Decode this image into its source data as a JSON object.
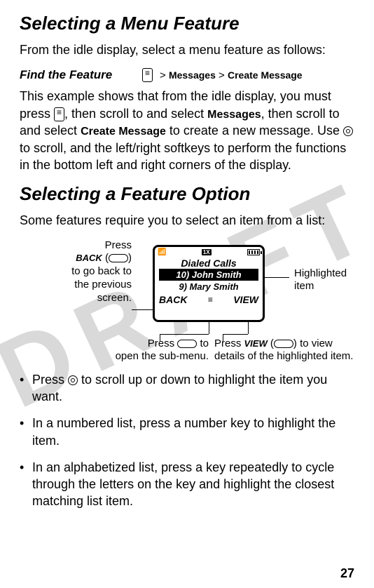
{
  "page_number": "27",
  "watermark": "DRAFT",
  "section1": {
    "heading": "Selecting a Menu Feature",
    "intro": "From the idle display, select a menu feature as follows:",
    "find_label": "Find the Feature",
    "path_sep": ">",
    "path_item1": "Messages",
    "path_item2": "Create Message",
    "example_p1": "This example shows that from the idle display, you must press ",
    "example_p2": ", then scroll to and select ",
    "example_bold1": "Messages",
    "example_p3": ", then scroll to and select ",
    "example_bold2": "Create Message",
    "example_p4": " to create a new message. Use ",
    "example_p5": " to scroll, and the left/right softkeys to perform the functions in the bottom left and right corners of the display."
  },
  "section2": {
    "heading": "Selecting a Feature Option",
    "intro": "Some features require you to select an item from a list:"
  },
  "diagram": {
    "screen_title": "Dialed Calls",
    "list_item1": "10) John Smith",
    "list_item2": "9) Mary Smith",
    "softkey_left": "BACK",
    "softkey_right": "VIEW",
    "status_ix": "1X",
    "callout_left_p1": "Press",
    "callout_left_back": "BACK",
    "callout_left_p2": "to go back to",
    "callout_left_p3": "the previous",
    "callout_left_p4": "screen.",
    "callout_right_p1": "Highlighted",
    "callout_right_p2": "item",
    "callout_bl_p1": "Press ",
    "callout_bl_p2": " to",
    "callout_bl_p3": "open the sub-menu.",
    "callout_br_p1": "Press ",
    "callout_br_view": "VIEW",
    "callout_br_p2": " (",
    "callout_br_p3": ") to view",
    "callout_br_p4": "details of the highlighted item."
  },
  "bullets": {
    "b1_p1": "Press ",
    "b1_p2": " to scroll up or down to highlight the item you want.",
    "b2": "In a numbered list, press a number key to highlight the item.",
    "b3": "In an alphabetized list, press a key repeatedly to cycle through the letters on the key and highlight the closest matching list item."
  }
}
